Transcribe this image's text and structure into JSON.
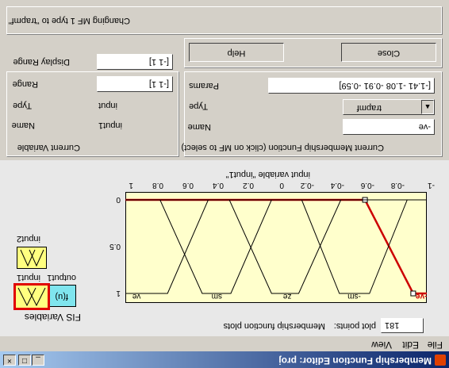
{
  "window": {
    "title": "Membership Function Editor: proj"
  },
  "menu": [
    "File",
    "Edit",
    "View"
  ],
  "plot": {
    "points_label": "plot points:",
    "points_value": "181",
    "membership_title": "Membership function plots",
    "xlabel": "input variable \"input1\"",
    "x_ticks": [
      "-1",
      "-0.8",
      "-0.6",
      "-0.4",
      "-0.2",
      "0",
      "0.2",
      "0.4",
      "0.6",
      "0.8",
      "1"
    ],
    "y_ticks": [
      "1",
      "0.5",
      "0"
    ],
    "mf_labels": [
      "-ve",
      "-sm",
      "ze",
      "sm",
      "ve"
    ]
  },
  "fis": {
    "label": "FIS Variables",
    "input1": "input1",
    "input2": "input2",
    "output1": "output1",
    "output_fn": "f(u)"
  },
  "current_variable": {
    "title": "Current Variable",
    "name_label": "Name",
    "name_value": "input1",
    "type_label": "Type",
    "type_value": "input",
    "range_label": "Range",
    "range_value": "[-1 1]",
    "display_label": "Display Range",
    "display_value": "[-1 1]"
  },
  "current_mf": {
    "title": "Current Membership Function (click on MF to select)",
    "name_label": "Name",
    "name_value": "-ve",
    "type_label": "Type",
    "type_value": "trapmf",
    "params_label": "Params",
    "params_value": "[-1.41 -1.08 -0.91 -0.59]"
  },
  "buttons": {
    "help": "Help",
    "close": "Close"
  },
  "status": "Changing MF 1 type to \"trapmf\"",
  "chart_data": {
    "type": "line",
    "xlim": [
      -1,
      1
    ],
    "ylim": [
      0,
      1
    ],
    "series": [
      {
        "name": "-ve",
        "points": [
          [
            -1.0,
            1.0
          ],
          [
            -0.91,
            1.0
          ],
          [
            -0.59,
            0.0
          ],
          [
            1.0,
            0.0
          ]
        ],
        "color": "#cc0000"
      },
      {
        "name": "-sm",
        "points": [
          [
            -1.0,
            0.0
          ],
          [
            -0.87,
            0.0
          ],
          [
            -0.62,
            1.0
          ],
          [
            -0.42,
            1.0
          ],
          [
            -0.17,
            0.0
          ],
          [
            1.0,
            0.0
          ]
        ],
        "color": "#000000"
      },
      {
        "name": "ze",
        "points": [
          [
            -1.0,
            0.0
          ],
          [
            -0.43,
            0.0
          ],
          [
            -0.15,
            1.0
          ],
          [
            0.03,
            1.0
          ],
          [
            0.31,
            0.0
          ],
          [
            1.0,
            0.0
          ]
        ],
        "color": "#000000"
      },
      {
        "name": "sm",
        "points": [
          [
            -1.0,
            0.0
          ],
          [
            0.03,
            0.0
          ],
          [
            0.3,
            1.0
          ],
          [
            0.49,
            1.0
          ],
          [
            0.77,
            0.0
          ],
          [
            1.0,
            0.0
          ]
        ],
        "color": "#000000"
      },
      {
        "name": "ve",
        "points": [
          [
            -1.0,
            0.0
          ],
          [
            0.45,
            0.0
          ],
          [
            0.72,
            1.0
          ],
          [
            1.0,
            1.0
          ]
        ],
        "color": "#000000"
      }
    ]
  }
}
